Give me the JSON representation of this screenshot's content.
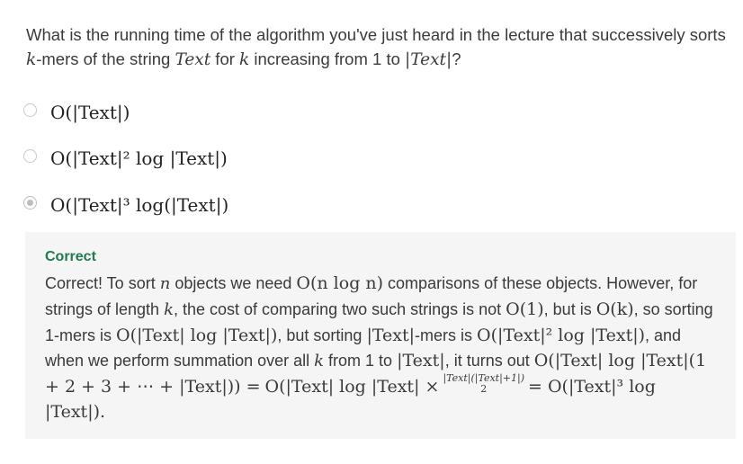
{
  "question": {
    "prefix": "What is the running time of the algorithm you've just heard in the lecture that successively sorts ",
    "k_mers": "k",
    "middle1": "-mers of the string ",
    "text_var": "Text",
    "middle2": " for ",
    "k_var": "k",
    "middle3": " increasing from 1 to ",
    "abs_text": "|Text|",
    "suffix": "?"
  },
  "options": [
    {
      "label": "O(|Text|)",
      "selected": false
    },
    {
      "label": "O(|Text|² log |Text|)",
      "selected": false
    },
    {
      "label": "O(|Text|³ log(|Text|)",
      "selected": true
    }
  ],
  "feedback": {
    "title": "Correct",
    "s1": "Correct! To sort ",
    "n": "n",
    "s2": " objects we need ",
    "onlogn": "O(n log n)",
    "s3": " comparisons of these objects. However, for strings of length ",
    "k": "k",
    "s4": ", the cost of comparing two such strings is not ",
    "o1": "O(1)",
    "s5": ", but is ",
    "ok": "O(k)",
    "s6": ", so sorting 1-mers is ",
    "m1": "O(|Text| log |Text|)",
    "s7": ", but sorting ",
    "m2": "|Text|",
    "s8": "-mers is ",
    "m3": "O(|Text|² log |Text|)",
    "s9": ", and when we perform summation over all ",
    "k2": "k",
    "s10": " from 1 to ",
    "m4": "|Text|",
    "s11": ", it turns out ",
    "m5": "O(|Text| log |Text|(1 + 2 + 3 + ⋯ + |Text|)) =",
    "m6": "O(|Text| log |Text| ×",
    "frac_num": "|Text|(|Text|+1|)",
    "frac_den": "2",
    "m7": "= O(|Text|³ log |Text|)."
  }
}
